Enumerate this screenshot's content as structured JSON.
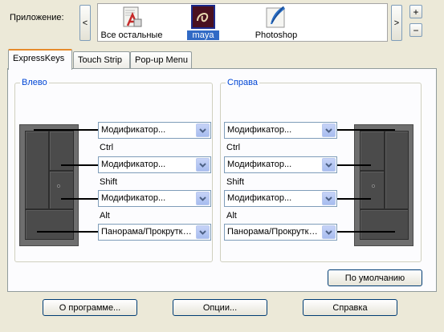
{
  "app_label": "Приложение:",
  "nav": {
    "prev": "<",
    "next": ">"
  },
  "apps": [
    {
      "label": "Все остальные",
      "icon": "all-apps-icon"
    },
    {
      "label": "maya",
      "icon": "maya-icon",
      "selected": true
    },
    {
      "label": "Photoshop",
      "icon": "photoshop-icon"
    }
  ],
  "pm": {
    "add": "+",
    "remove": "−"
  },
  "tabs": [
    "ExpressKeys",
    "Touch Strip",
    "Pop-up Menu"
  ],
  "left_group": {
    "title": "Влево",
    "keys": [
      {
        "value": "Модификатор...",
        "label": "Ctrl"
      },
      {
        "value": "Модификатор...",
        "label": "Shift"
      },
      {
        "value": "Модификатор...",
        "label": "Alt"
      },
      {
        "value": "Панорама/Прокрутка...",
        "label": ""
      }
    ]
  },
  "right_group": {
    "title": "Справа",
    "keys": [
      {
        "value": "Модификатор...",
        "label": "Ctrl"
      },
      {
        "value": "Модификатор...",
        "label": "Shift"
      },
      {
        "value": "Модификатор...",
        "label": "Alt"
      },
      {
        "value": "Панорама/Прокрутка...",
        "label": ""
      }
    ]
  },
  "default_button": "По умолчанию",
  "footer": {
    "about": "О программе...",
    "options": "Опции...",
    "help": "Справка"
  }
}
